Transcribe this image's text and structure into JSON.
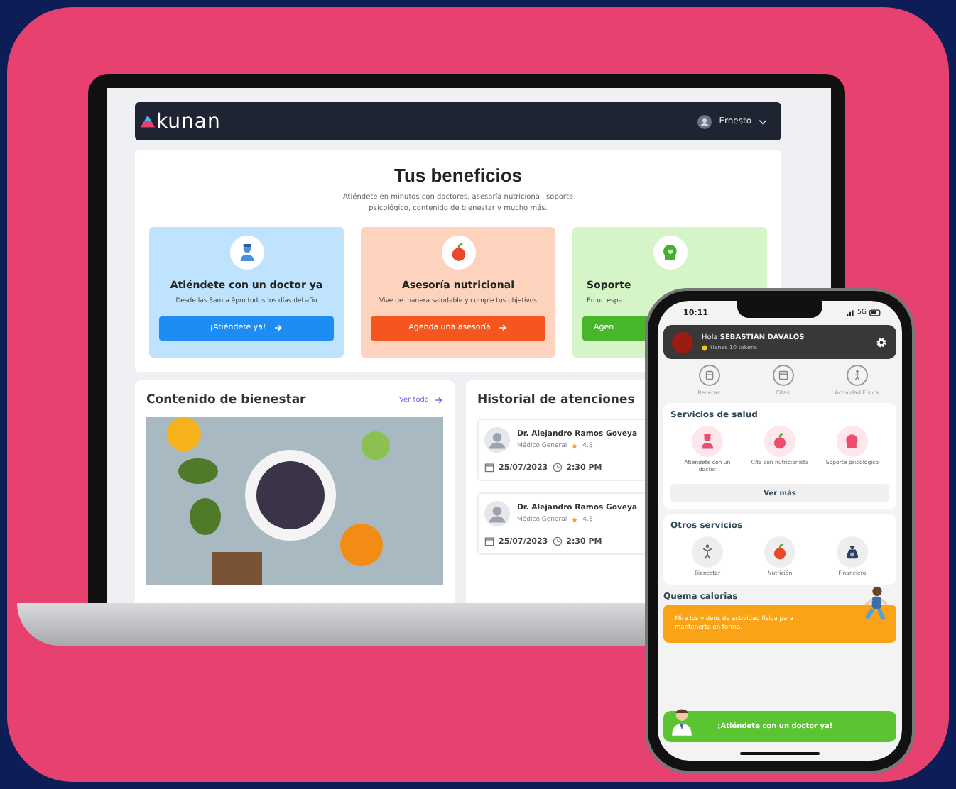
{
  "laptop": {
    "header": {
      "logo": "kunan",
      "user": "Ernesto"
    },
    "benefits": {
      "title": "Tus beneficios",
      "subtitle": "Atiéndete en minutos con doctores, asesoría nutricional, soporte psicológico, contenido de bienestar y mucho más.",
      "cards": [
        {
          "kind": "doctor",
          "title": "Atiéndete con un doctor ya",
          "description": "Desde las 8am a 9pm todos los días del año",
          "button": "¡Atiéndete ya!"
        },
        {
          "kind": "nutrition",
          "title": "Asesoría nutricional",
          "description": "Vive de manera saludable y cumple tus objetivos",
          "button": "Agenda una asesoría"
        },
        {
          "kind": "psychology",
          "title": "Soporte",
          "description": "En un espa",
          "button": "Agen"
        }
      ]
    },
    "wellness": {
      "title": "Contenido de bienestar",
      "link": "Ver todo"
    },
    "history": {
      "title": "Historial de atenciones",
      "items": [
        {
          "doctor": "Dr. Alejandro Ramos Goveya",
          "specialty": "Médico General",
          "rating": "4.8",
          "date": "25/07/2023",
          "time": "2:30 PM"
        },
        {
          "doctor": "Dr. Alejandro Ramos Goveya",
          "specialty": "Médico General",
          "rating": "4.8",
          "date": "25/07/2023",
          "time": "2:30 PM"
        }
      ]
    }
  },
  "phone": {
    "time": "10:11",
    "network": "5G",
    "greeting": "Hola **SEBASTIAN DAVALOS**",
    "tokens": "tienes 10 tokens",
    "shortcuts": [
      {
        "kind": "prescription",
        "label": "Recetas"
      },
      {
        "kind": "calendar",
        "label": "Citas"
      },
      {
        "kind": "exercise",
        "label": "Actividad Física"
      }
    ],
    "health": {
      "title": "Servicios de salud",
      "items": [
        {
          "kind": "doctor",
          "label": "Atiéndete con un doctor"
        },
        {
          "kind": "nutrition",
          "label": "Cita con nutricionista"
        },
        {
          "kind": "psychology",
          "label": "Soporte psicológico"
        }
      ],
      "button": "Ver más"
    },
    "others": {
      "title": "Otros servicios",
      "items": [
        {
          "kind": "wellbeing",
          "label": "Bienestar"
        },
        {
          "kind": "nutrition",
          "label": "Nutrición"
        },
        {
          "kind": "finance",
          "label": "Financiero"
        }
      ]
    },
    "burn": {
      "title": "Quema calorias",
      "text": "Mira los videos de actividad física para mantenerte en forma."
    },
    "cta": "¡Atiéndete con un doctor ya!"
  }
}
